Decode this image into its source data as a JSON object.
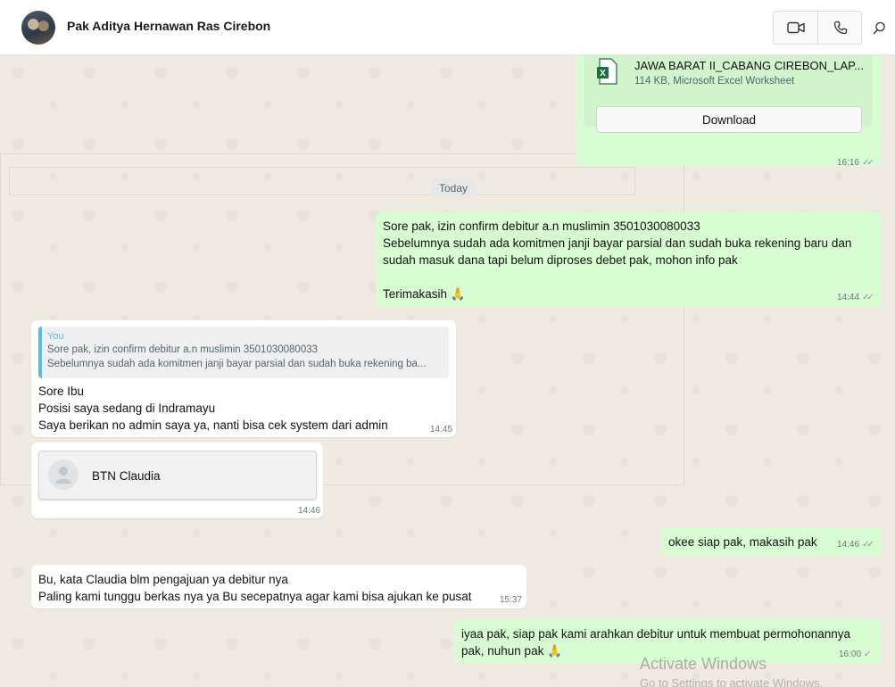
{
  "header": {
    "contact_name": "Pak Aditya Hernawan Ras Cirebon",
    "video_call_icon": "video-camera-icon",
    "voice_call_icon": "phone-icon",
    "search_icon": "search-icon"
  },
  "messages": {
    "file_message": {
      "file_name": "JAWA BARAT II_CABANG CIREBON_LAP...",
      "file_meta": "114 KB, Microsoft Excel Worksheet",
      "download_label": "Download",
      "time": "16:16",
      "status": "read"
    },
    "day_separator": "Today",
    "msg1": {
      "lines": [
        "Sore pak, izin confirm debitur a.n muslimin 3501030080033",
        "Sebelumnya sudah ada komitmen janji bayar parsial dan sudah buka rekening baru dan",
        "sudah masuk dana tapi belum diproses debet pak, mohon info pak",
        "Terimakasih 🙏"
      ],
      "time": "14:44"
    },
    "msg2": {
      "quote_author": "You",
      "quote_line1": "Sore pak, izin confirm debitur a.n muslimin 3501030080033",
      "quote_line2": "Sebelumnya sudah ada komitmen janji bayar parsial dan sudah buka rekening ba...",
      "lines": [
        "Sore Ibu",
        "Posisi saya sedang di Indramayu",
        "Saya berikan no admin saya ya, nanti bisa cek system dari admin"
      ],
      "time": "14:45"
    },
    "msg3": {
      "contact_name": "BTN Claudia",
      "time": "14:46"
    },
    "msg4": {
      "text": "okee siap pak, makasih pak",
      "time": "14:46"
    },
    "msg5": {
      "lines": [
        "Bu, kata Claudia blm pengajuan ya debitur nya",
        "Paling kami tunggu berkas nya ya Bu secepatnya agar kami bisa ajukan ke pusat"
      ],
      "time": "15:37"
    },
    "msg6": {
      "lines": [
        "iyaa pak, siap pak kami arahkan debitur untuk membuat permohonannya",
        "pak, nuhun pak 🙏"
      ],
      "time": "16:00"
    }
  },
  "watermark": {
    "line1": "Activate Windows",
    "line2": "Go to Settings to activate Windows."
  },
  "colors": {
    "outgoing_bubble": "#d9fdd3",
    "incoming_bubble": "#ffffff",
    "chat_background": "#efeae2",
    "quote_accent": "#53bdeb"
  }
}
